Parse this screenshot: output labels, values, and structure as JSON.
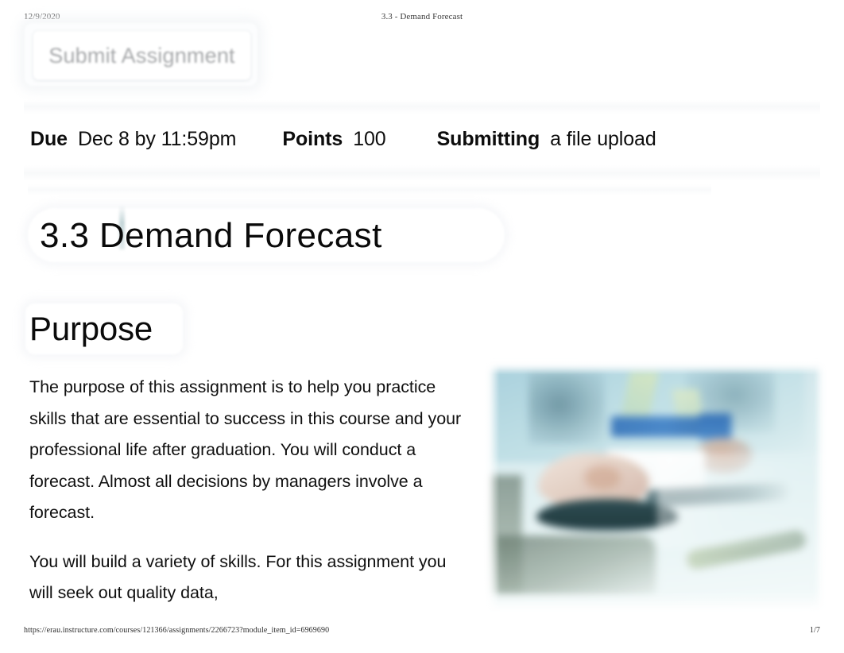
{
  "print_header": {
    "date": "12/9/2020",
    "document_title": "3.3 - Demand Forecast"
  },
  "print_footer": {
    "url": "https://erau.instructure.com/courses/121366/assignments/2266723?module_item_id=6969690",
    "page_indicator": "1/7"
  },
  "toolbar": {
    "submit_label": "Submit Assignment"
  },
  "assignment_meta": {
    "due_label": "Due",
    "due_value": "Dec 8 by 11:59pm",
    "points_label": "Points",
    "points_value": "100",
    "submitting_label": "Submitting",
    "submitting_value": "a file upload"
  },
  "content": {
    "title": "3.3  Demand  Forecast",
    "section_heading": "Purpose",
    "paragraphs": [
      "The purpose of this assignment is to help you practice skills that are essential to success in this course and your professional life after graduation. You will conduct a forecast. Almost all decisions by managers involve a forecast.",
      "You will build a variety of skills. For this assignment you will seek out quality data,"
    ]
  },
  "colors": {
    "text": "#101010",
    "muted_button_text": "#a7a9ab",
    "band": "#fafbfc",
    "photo_accent": "#3b7ec6"
  }
}
